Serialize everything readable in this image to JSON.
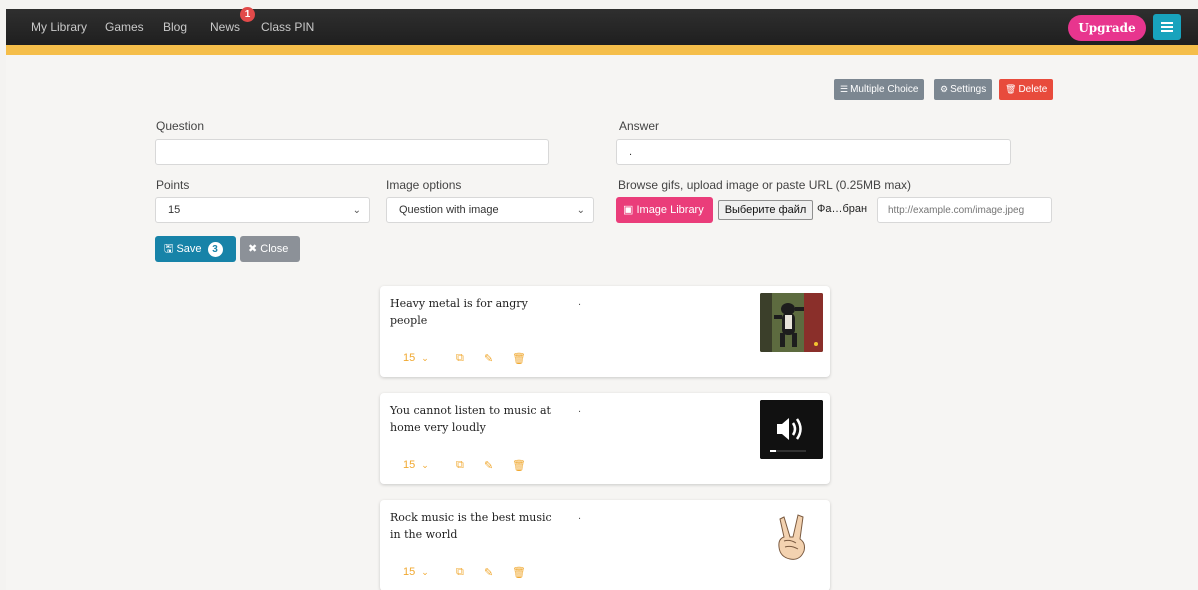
{
  "nav": {
    "items": [
      "My Library",
      "Games",
      "Blog",
      "News",
      "Class PIN"
    ],
    "news_badge": "1",
    "upgrade_label": "Upgrade"
  },
  "toolbar": {
    "multiple_choice": "Multiple Choice",
    "settings": "Settings",
    "delete": "Delete"
  },
  "form": {
    "question_label": "Question",
    "question_value": "",
    "answer_label": "Answer",
    "answer_value": ".",
    "points_label": "Points",
    "points_value": "15",
    "image_options_label": "Image options",
    "image_options_value": "Question with image",
    "browse_label": "Browse gifs, upload image or paste URL (0.25MB max)",
    "image_library_label": "Image Library",
    "file_button_label": "Выберите файл",
    "file_name": "Фа…бран",
    "url_placeholder": "http://example.com/image.jpeg",
    "save_label": "Save",
    "save_count": "3",
    "close_label": "Close"
  },
  "cards": [
    {
      "question": "Heavy metal is for angry people",
      "answer": ".",
      "points": "15",
      "image": "cartoon-cat-dancing"
    },
    {
      "question": "You cannot listen to music at home very loudly",
      "answer": ".",
      "points": "15",
      "image": "speaker-volume"
    },
    {
      "question": "Rock music is the best music in the world",
      "answer": ".",
      "points": "15",
      "image": "rock-hand"
    }
  ],
  "colors": {
    "nav_bg": "#262626",
    "stripe": "#f5be4a",
    "upgrade": "#e8358e",
    "menu": "#18a3bd",
    "delete": "#e84b3c",
    "toolbar_gray": "#7c8791",
    "image_library": "#ea3d7a",
    "save": "#1783a8",
    "close": "#8c9198",
    "card_icons": "#f0a830"
  }
}
